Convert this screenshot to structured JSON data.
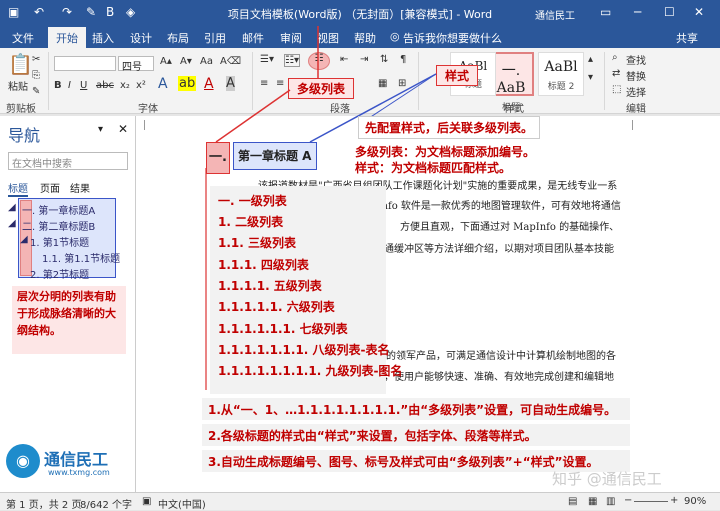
{
  "titlebar": {
    "title": "项目文档模板(Word版) （无封面）[兼容模式] - Word",
    "user": "通信民工"
  },
  "tabs": [
    "文件",
    "开始",
    "插入",
    "设计",
    "布局",
    "引用",
    "邮件",
    "审阅",
    "视图",
    "帮助"
  ],
  "tell_me": "告诉我你想要做什么",
  "share": "共享",
  "ribbon": {
    "paste": "粘贴",
    "clipboard": "剪贴板",
    "font_group": "字体",
    "para_group": "段落",
    "style_group": "样式",
    "edit_group": "编辑",
    "font_size": "四号",
    "multilevel_tag": "多级列表",
    "style_tag": "样式",
    "styles": [
      {
        "big": "一. AaB",
        "label": "标题"
      },
      {
        "big": "AaBl",
        "label": "标题 1"
      },
      {
        "big": "AaBl",
        "label": "标题 2"
      }
    ],
    "find": "查找",
    "replace": "替换",
    "select": "选择"
  },
  "nav": {
    "title": "导航",
    "search_placeholder": "在文档中搜索",
    "tabs": [
      "标题",
      "页面",
      "结果"
    ],
    "items": [
      "一. 第一章标题A",
      "二. 第二章标题B",
      "1. 第1节标题",
      "1.1. 第1.1节标题",
      "2. 第2节标题"
    ],
    "note": "层次分明的列表有助于形成脉络清晰的大纲结构。"
  },
  "doc": {
    "heading_number": "一.",
    "heading_text": "第一章标题 A",
    "callout1": "先配置样式，后关联多级列表。",
    "callout2_line1": "多级列表：为文档标题添加编号。",
    "callout2_line2": "样式：为文档标题匹配样式。",
    "body1": "该报道数材是\"广西省目组团队工作课题化计划\"实施的重要成果，是无线专业一系",
    "body2": "MapInfo 软件是一款优秀的地图管理软件，可有效地将通信",
    "body3": "方便且直观，下面通过对 MapInfo 的基础操作、",
    "body4": "通缓冲区等方法详细介绍，以期对项目团队基本技能",
    "body5": "的领军产品，可满足通信设计中计算机绘制地图的各",
    "body6": "，使用户能够快速、准确、有效地完成创建和编辑地",
    "levels": [
      "一. 一级列表",
      "1. 二级列表",
      "1.1. 三级列表",
      "1.1.1. 四级列表",
      "1.1.1.1. 五级列表",
      "1.1.1.1.1. 六级列表",
      "1.1.1.1.1.1. 七级列表",
      "1.1.1.1.1.1.1. 八级列表-表名",
      "1.1.1.1.1.1.1.1. 九级列表-图名"
    ],
    "notes": [
      "1.从“一、1、…1.1.1.1.1.1.1.1.”由“多级列表”设置，可自动生成编号。",
      "2.各级标题的样式由“样式”来设置，包括字体、段落等样式。",
      "3.自动生成标题编号、图号、标号及样式可由“多级列表”+“样式”设置。"
    ]
  },
  "logo": {
    "name": "通信民工",
    "url": "www.txmg.com"
  },
  "watermark": "知乎 @通信民工",
  "status": {
    "page": "第 1 页，共 2 页",
    "words": "8/642 个字",
    "lang": "中文(中国)",
    "zoom": "90%"
  },
  "colors": {
    "accent": "#2b579a",
    "red": "#c00000"
  }
}
